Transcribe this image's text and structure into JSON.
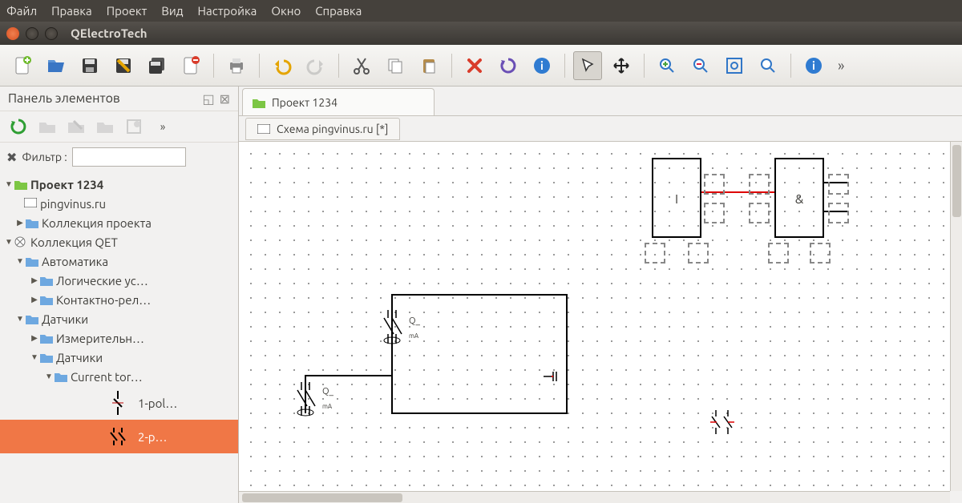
{
  "menu": {
    "items": [
      "Файл",
      "Правка",
      "Проект",
      "Вид",
      "Настройка",
      "Окно",
      "Справка"
    ]
  },
  "window": {
    "title": "QElectroTech"
  },
  "sidebar": {
    "panel_title": "Панель элементов",
    "filter_label": "Фильтр :",
    "tree": {
      "project": "Проект 1234",
      "diagram": "pingvinus.ru",
      "project_collection": "Коллекция проекта",
      "qet_collection": "Коллекция QET",
      "automation": "Автоматика",
      "logic": "Логические ус…",
      "contact_relay": "Контактно-рел…",
      "sensors": "Датчики",
      "measurement": "Измерительн…",
      "sensors2": "Датчики",
      "current_tor": "Current tor…",
      "element1": "1-pol…",
      "element2": "2-p…"
    }
  },
  "editor": {
    "project_tab": "Проект 1234",
    "doc_tab": "Схема pingvinus.ru [*]",
    "logic_block1": "I",
    "logic_block2": "&",
    "switch_label": "Q_",
    "switch_unit": "mA"
  }
}
